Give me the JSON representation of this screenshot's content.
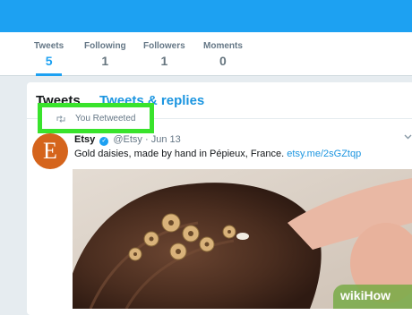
{
  "profile_stats": [
    {
      "label": "Tweets",
      "value": "5",
      "active": true
    },
    {
      "label": "Following",
      "value": "1"
    },
    {
      "label": "Followers",
      "value": "1"
    },
    {
      "label": "Moments",
      "value": "0"
    }
  ],
  "tabs": [
    {
      "label": "Tweets",
      "active": true
    },
    {
      "label": "Tweets & replies"
    }
  ],
  "retweet_context": {
    "icon": "retweet-icon",
    "text": "You Retweeted"
  },
  "tweet": {
    "avatar_letter": "E",
    "author": "Etsy",
    "handle": "@Etsy",
    "separator": "·",
    "date": "Jun 13",
    "text": "Gold daisies, made by hand in Pépieux, France.",
    "link": "etsy.me/2sGZtqp"
  },
  "watermark": {
    "text": "wikiHow"
  },
  "colors": {
    "accent": "#1da1f2",
    "highlight_box": "#39e32c",
    "avatar_bg": "#d5641c"
  }
}
